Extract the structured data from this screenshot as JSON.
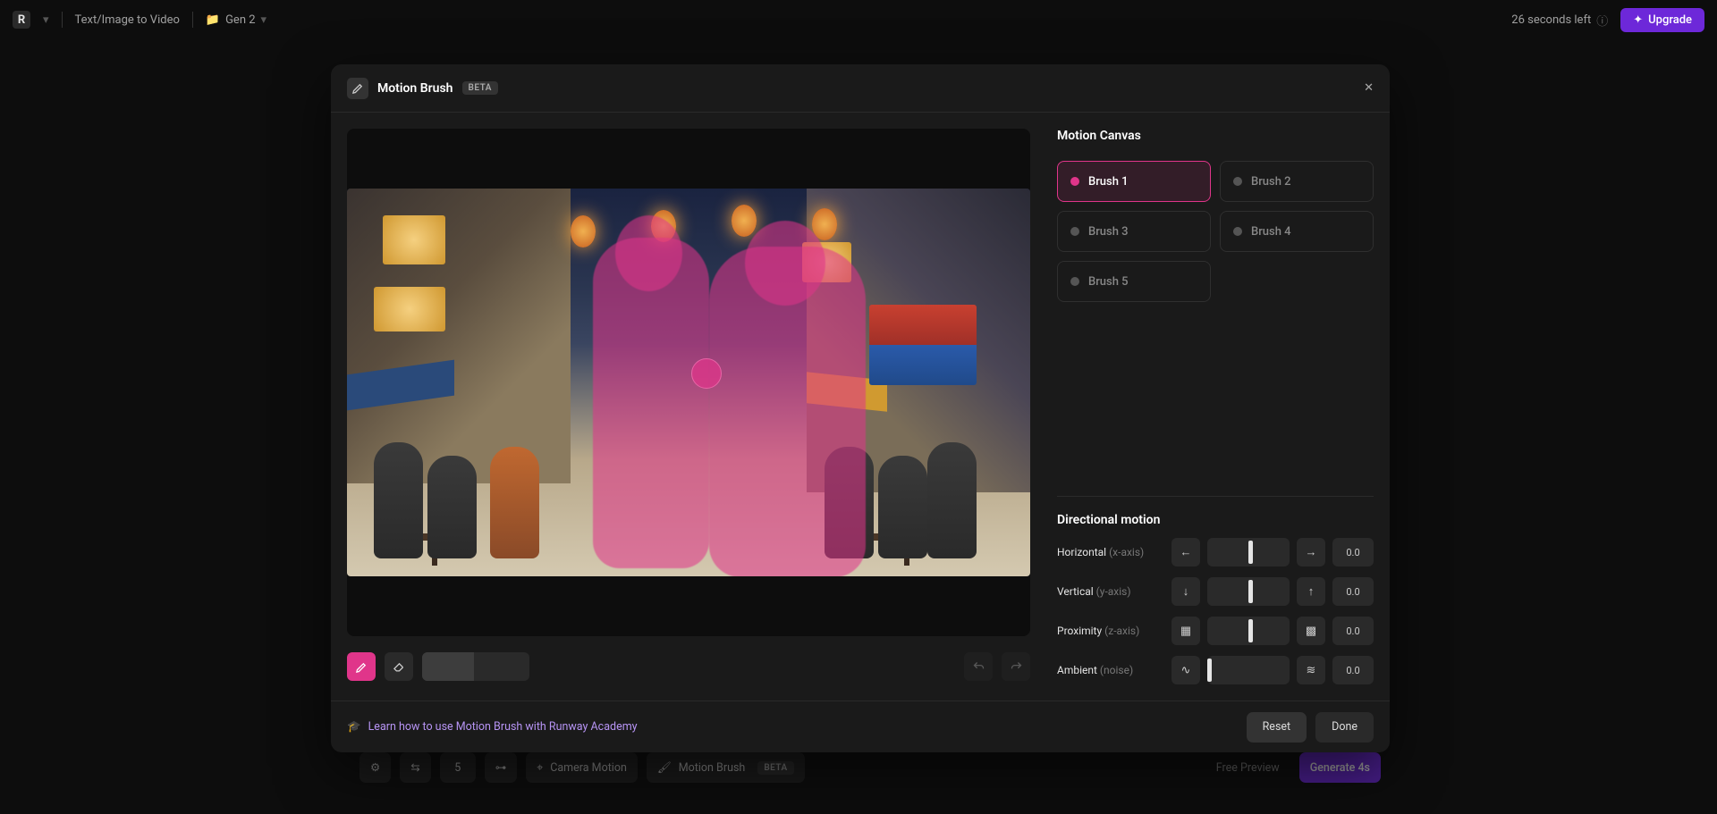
{
  "topbar": {
    "page_label": "Text/Image to Video",
    "project_label": "Gen 2",
    "seconds_left": "26 seconds left",
    "upgrade": "Upgrade"
  },
  "modal": {
    "title": "Motion Brush",
    "beta": "BETA",
    "motion_canvas_title": "Motion Canvas",
    "brushes": [
      "Brush 1",
      "Brush 2",
      "Brush 3",
      "Brush 4",
      "Brush 5"
    ],
    "active_brush": 0,
    "directional_title": "Directional motion",
    "rows": {
      "horizontal": {
        "label": "Horizontal",
        "axis": "(x-axis)",
        "value": "0.0"
      },
      "vertical": {
        "label": "Vertical",
        "axis": "(y-axis)",
        "value": "0.0"
      },
      "proximity": {
        "label": "Proximity",
        "axis": "(z-axis)",
        "value": "0.0"
      },
      "ambient": {
        "label": "Ambient",
        "axis": "(noise)",
        "value": "0.0"
      }
    },
    "learn": "Learn how to use Motion Brush with Runway Academy",
    "reset": "Reset",
    "done": "Done"
  },
  "bottom": {
    "value": "5",
    "camera": "Camera Motion",
    "brush": "Motion Brush",
    "beta": "BETA",
    "preview": "Free Preview",
    "generate": "Generate 4s"
  },
  "icons": {
    "logo": "R",
    "arrow_left": "←",
    "arrow_right": "→",
    "arrow_up": "↑",
    "arrow_down": "↓",
    "close": "✕",
    "wave": "∿",
    "noise": "≋"
  }
}
